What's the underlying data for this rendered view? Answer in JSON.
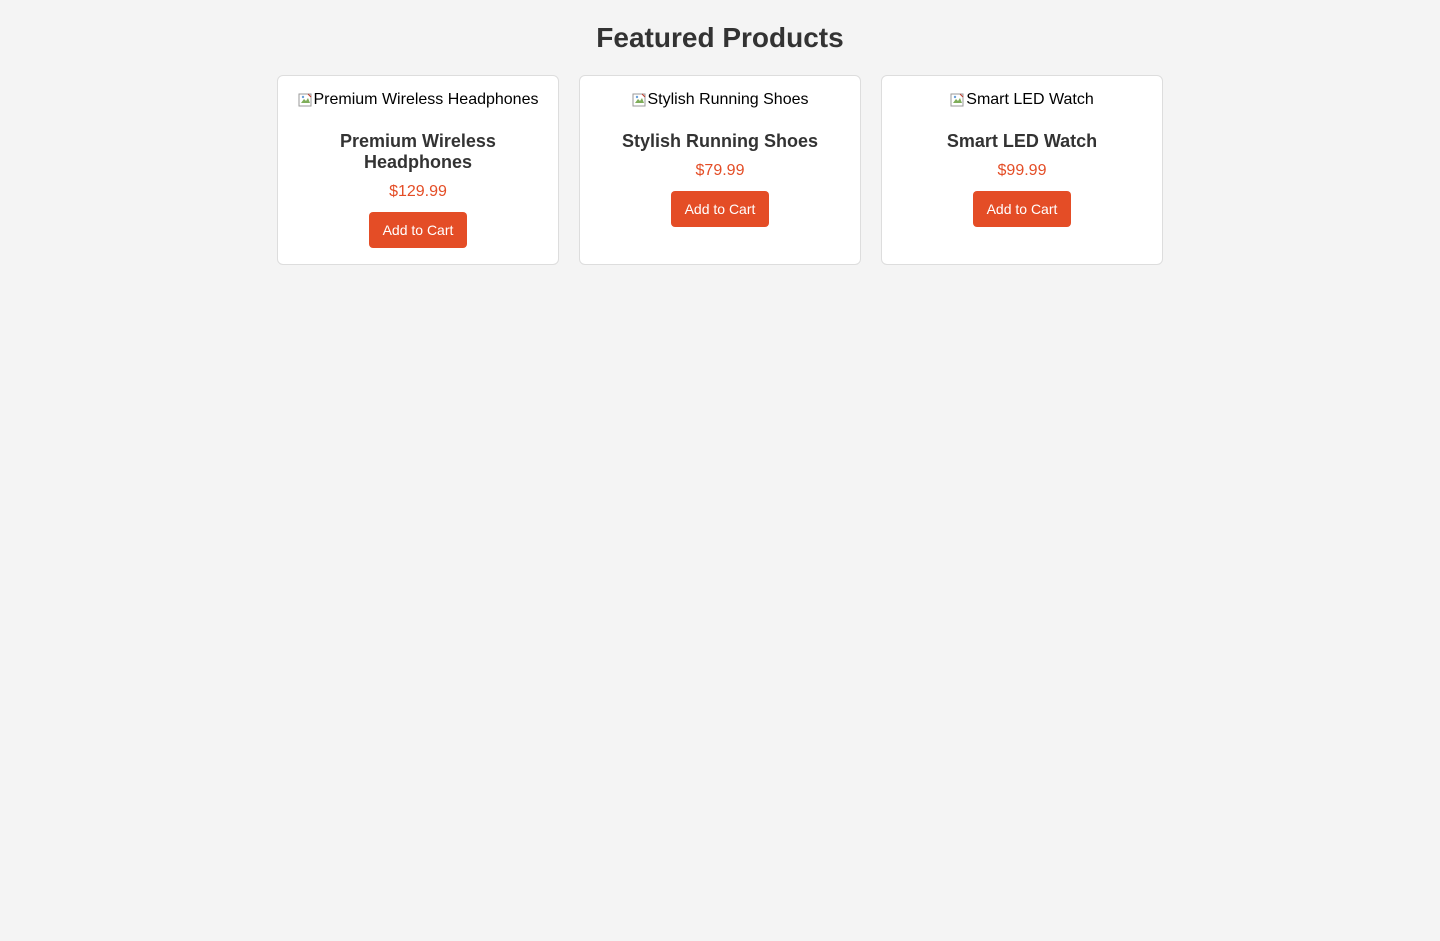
{
  "page": {
    "title": "Featured Products"
  },
  "theme": {
    "background": "#f4f4f4",
    "accent": "#e44d26",
    "card_background": "#ffffff",
    "text_color": "#333333"
  },
  "products": [
    {
      "image_alt": "Premium Wireless Headphones",
      "name": "Premium Wireless Headphones",
      "price": "$129.99",
      "button_label": "Add to Cart",
      "image_icon": "broken-image-icon"
    },
    {
      "image_alt": "Stylish Running Shoes",
      "name": "Stylish Running Shoes",
      "price": "$79.99",
      "button_label": "Add to Cart",
      "image_icon": "broken-image-icon"
    },
    {
      "image_alt": "Smart LED Watch",
      "name": "Smart LED Watch",
      "price": "$99.99",
      "button_label": "Add to Cart",
      "image_icon": "broken-image-icon"
    }
  ]
}
